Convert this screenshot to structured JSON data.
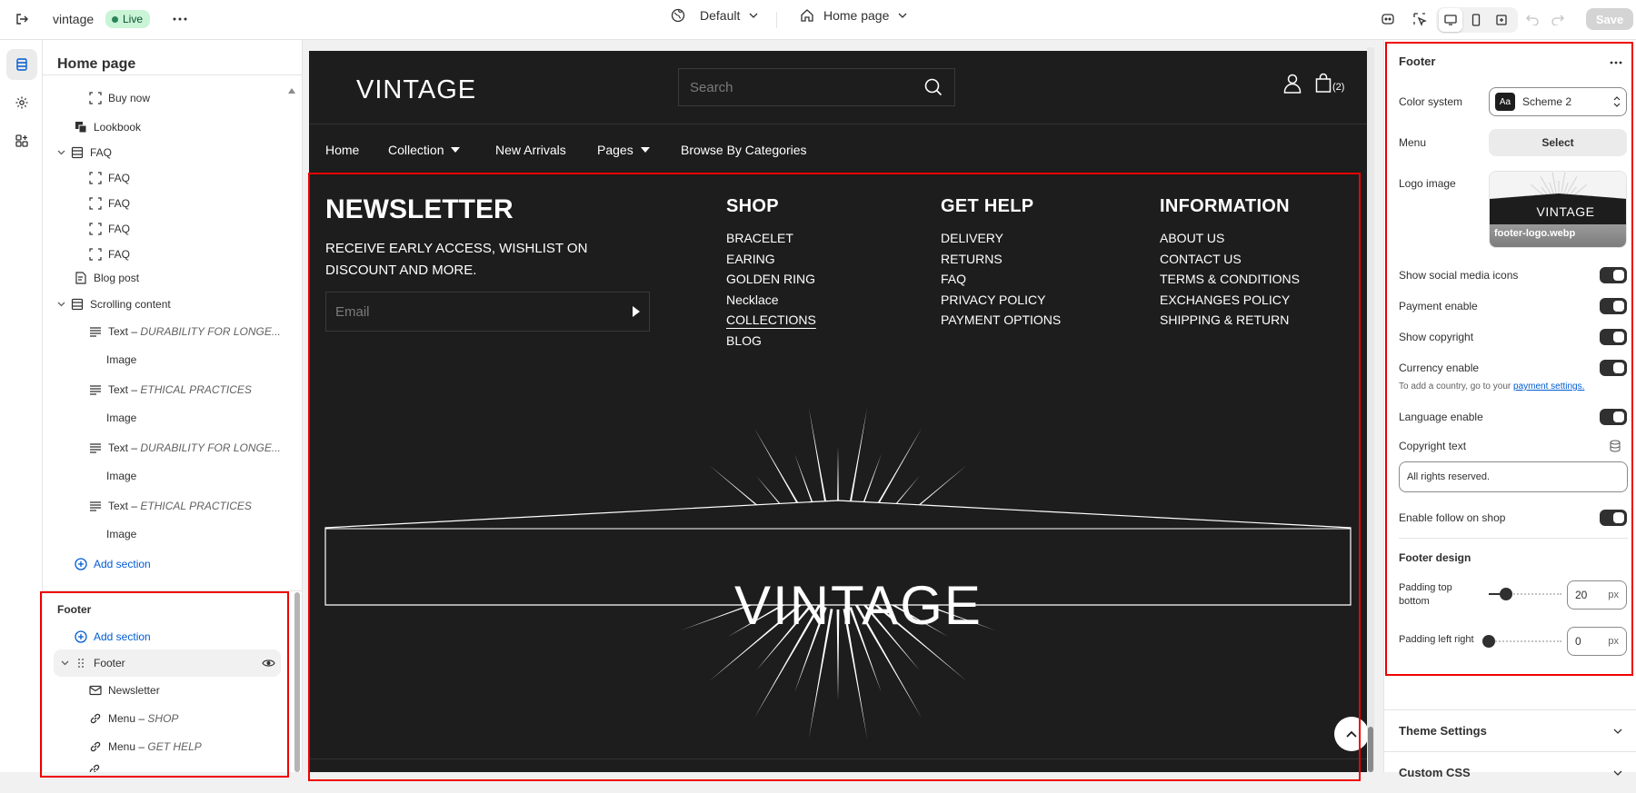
{
  "topbar": {
    "store_name": "vintage",
    "live_badge": "Live",
    "theme": "Default",
    "page": "Home page",
    "save_label": "Save"
  },
  "sidebar": {
    "title": "Home page",
    "items": [
      {
        "label": "Buy now",
        "sub": "",
        "icon": "block-icon"
      },
      {
        "label": "Lookbook",
        "sub": "",
        "icon": "lookbook-icon"
      },
      {
        "label": "FAQ",
        "sub": "",
        "icon": "section-icon"
      },
      {
        "label": "FAQ",
        "sub": "",
        "icon": "block-icon"
      },
      {
        "label": "FAQ",
        "sub": "",
        "icon": "block-icon"
      },
      {
        "label": "FAQ",
        "sub": "",
        "icon": "block-icon"
      },
      {
        "label": "FAQ",
        "sub": "",
        "icon": "block-icon"
      },
      {
        "label": "Blog post",
        "sub": "",
        "icon": "blog-icon"
      },
      {
        "label": "Scrolling content",
        "sub": "",
        "icon": "section-icon"
      },
      {
        "label": "Text",
        "sub": "DURABILITY FOR LONGE...",
        "icon": "text-icon"
      },
      {
        "label": "Image",
        "sub": "",
        "icon": ""
      },
      {
        "label": "Text",
        "sub": "ETHICAL PRACTICES",
        "icon": "text-icon"
      },
      {
        "label": "Image",
        "sub": "",
        "icon": ""
      },
      {
        "label": "Text",
        "sub": "DURABILITY FOR LONGE...",
        "icon": "text-icon"
      },
      {
        "label": "Image",
        "sub": "",
        "icon": ""
      },
      {
        "label": "Text",
        "sub": "ETHICAL PRACTICES",
        "icon": "text-icon"
      },
      {
        "label": "Image",
        "sub": "",
        "icon": ""
      }
    ],
    "add_section": "Add section",
    "footer_group": "Footer",
    "footer_add_section": "Add section",
    "footer_items": [
      {
        "label": "Footer",
        "sub": ""
      },
      {
        "label": "Newsletter",
        "sub": ""
      },
      {
        "label": "Menu",
        "sub": "SHOP"
      },
      {
        "label": "Menu",
        "sub": "GET HELP"
      }
    ],
    "separator": "–"
  },
  "store": {
    "logo": "VINTAGE",
    "search_placeholder": "Search",
    "cart_count": "(2)",
    "nav": [
      "Home",
      "Collection",
      "New Arrivals",
      "Pages",
      "Browse By Categories"
    ],
    "newsletter_title": "NEWSLETTER",
    "newsletter_text_1": "RECEIVE EARLY ACCESS, WISHLIST ON",
    "newsletter_text_2": "DISCOUNT AND MORE.",
    "email_placeholder": "Email",
    "columns": [
      {
        "title": "SHOP",
        "links": [
          "BRACELET",
          "EARING",
          "GOLDEN RING",
          "Necklace",
          "COLLECTIONS",
          "BLOG"
        ]
      },
      {
        "title": "GET HELP",
        "links": [
          "DELIVERY",
          "RETURNS",
          "FAQ",
          "PRIVACY POLICY",
          "PAYMENT OPTIONS"
        ]
      },
      {
        "title": "INFORMATION",
        "links": [
          "ABOUT US",
          "CONTACT US",
          "TERMS & CONDITIONS",
          "EXCHANGES POLICY",
          "SHIPPING & RETURN"
        ]
      }
    ],
    "big_logo": "VINTAGE"
  },
  "panel": {
    "title": "Footer",
    "color_system_label": "Color system",
    "color_system_value": "Scheme 2",
    "scheme_badge": "Aa",
    "menu_label": "Menu",
    "menu_button": "Select",
    "logo_label": "Logo image",
    "logo_text": "VINTAGE",
    "logo_filename": "footer-logo.webp",
    "toggles": [
      "Show social media icons",
      "Payment enable",
      "Show copyright",
      "Currency enable"
    ],
    "currency_hint": "To add a country, go to your",
    "currency_link": "payment settings.",
    "language_label": "Language enable",
    "copyright_label": "Copyright text",
    "copyright_value": "All rights reserved.",
    "follow_label": "Enable follow on shop",
    "design_title": "Footer design",
    "padding_tb_label_1": "Padding top",
    "padding_tb_label_2": "bottom",
    "padding_tb_value": "20",
    "padding_lr_label": "Padding left right",
    "padding_lr_value": "0",
    "unit": "px",
    "theme_settings": "Theme Settings",
    "custom_css": "Custom CSS"
  },
  "colors": {
    "accent": "#005bd3",
    "live_bg": "#c9f4d6",
    "highlight": "#ee0000",
    "store_bg": "#1d1d1d"
  }
}
